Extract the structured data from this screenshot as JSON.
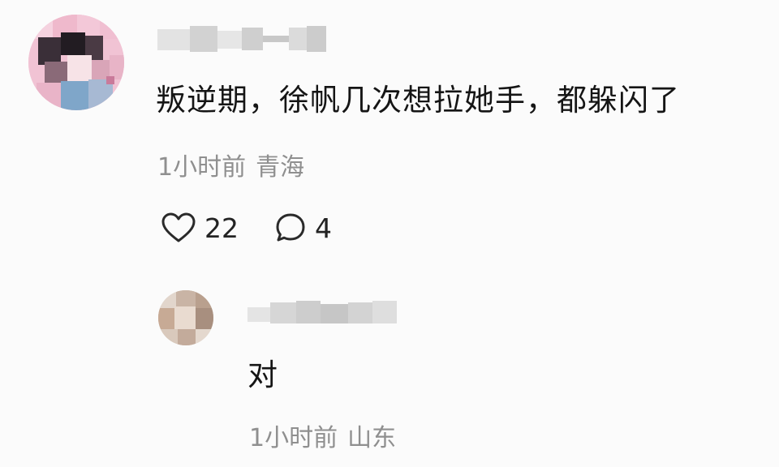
{
  "comment": {
    "text": "叛逆期，徐帆几次想拉她手，都躲闪了",
    "time": "1小时前",
    "location": "青海",
    "likes": "22",
    "replies_count": "4",
    "icons": {
      "like": "heart-outline-icon",
      "reply": "speech-bubble-icon"
    }
  },
  "reply": {
    "text": "对",
    "time": "1小时前",
    "location": "山东"
  },
  "colors": {
    "background": "#fbfbfb",
    "text_primary": "#151515",
    "text_secondary": "#8f8f8f"
  }
}
